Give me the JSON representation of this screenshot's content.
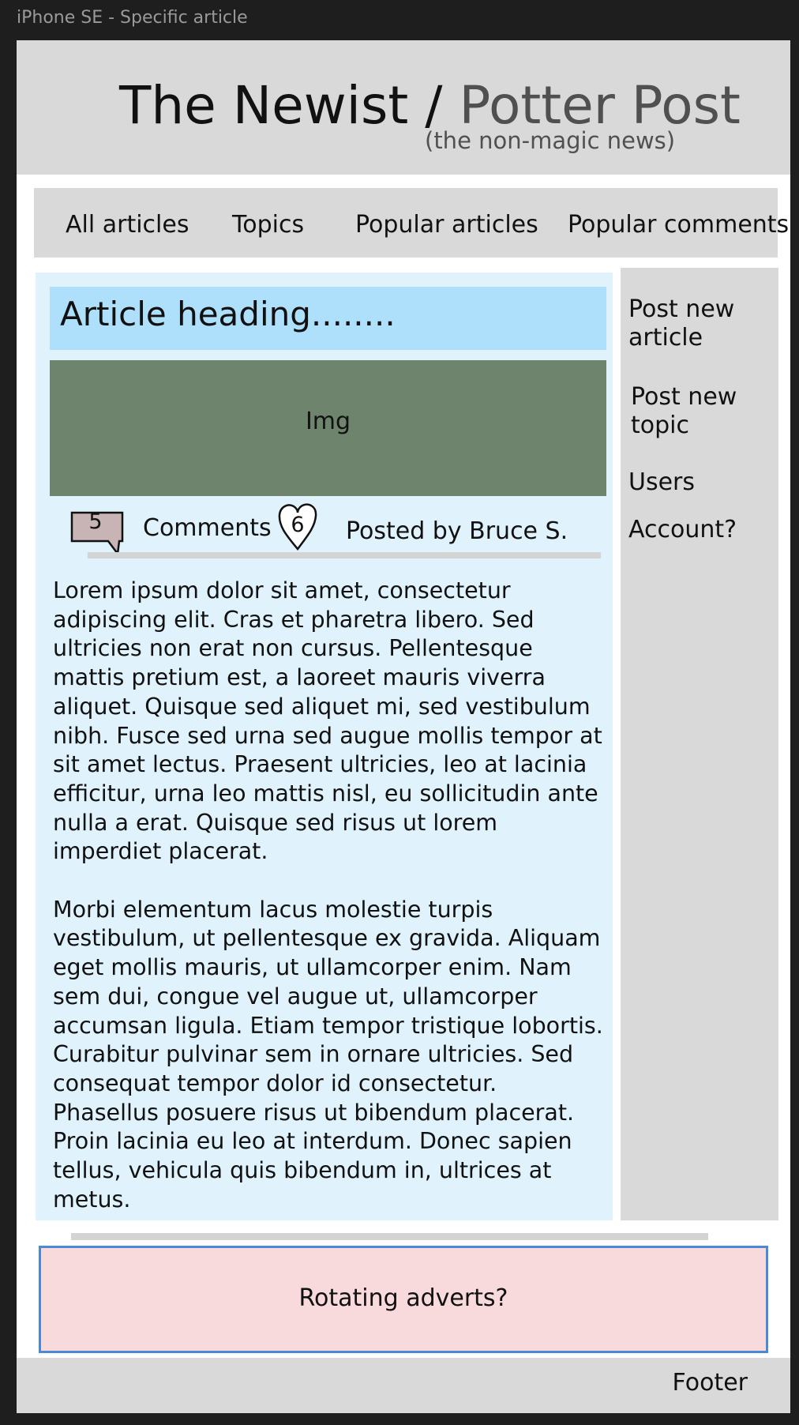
{
  "frame_label": "iPhone SE - Specific article",
  "header": {
    "title_main": "The Newist",
    "title_sep": " / ",
    "title_sub": "Potter Post",
    "subtitle": "(the non-magic news)"
  },
  "nav": {
    "items": [
      "All articles",
      "Topics",
      "Popular articles",
      "Popular comments"
    ]
  },
  "article": {
    "heading": "Article heading........",
    "image_label": "Img",
    "comment_count": "5",
    "comments_label": "Comments",
    "like_count": "6",
    "posted_by": "Posted by Bruce S.",
    "paragraphs": [
      "Lorem ipsum dolor sit amet, consectetur adipiscing elit. Cras et pharetra libero. Sed ultricies non erat non cursus. Pellentesque mattis pretium est, a laoreet mauris viverra aliquet. Quisque sed aliquet mi, sed vestibulum nibh. Fusce sed urna sed augue mollis tempor at sit amet lectus. Praesent ultricies, leo at lacinia efficitur, urna leo mattis nisl, eu sollicitudin ante nulla a erat. Quisque sed risus ut lorem imperdiet placerat.",
      "Morbi elementum lacus molestie turpis vestibulum, ut pellentesque ex gravida. Aliquam eget mollis mauris, ut ullamcorper enim. Nam sem dui, congue vel augue ut, ullamcorper accumsan ligula. Etiam tempor tristique lobortis. Curabitur pulvinar sem in ornare ultricies. Sed consequat tempor dolor id consectetur. Phasellus posuere risus ut bibendum placerat. Proin lacinia eu leo at interdum. Donec sapien tellus, vehicula quis bibendum in, ultrices at metus."
    ]
  },
  "sidebar": {
    "post_article": "Post new article",
    "post_topic": "Post new topic",
    "users": "Users",
    "account": "Account?"
  },
  "advert": "Rotating adverts?",
  "footer": "Footer",
  "colors": {
    "background": "#1e1e1e",
    "header": "#d9d9d9",
    "article_bg": "#e0f2fc",
    "heading_bg": "#aee0fc",
    "image_bg": "#6e846c",
    "advert_bg": "#f8dadd",
    "advert_border": "#4a88d8",
    "comment_fill": "#c8b4b4"
  },
  "icons": [
    "comment-bubble-icon",
    "heart-icon"
  ]
}
